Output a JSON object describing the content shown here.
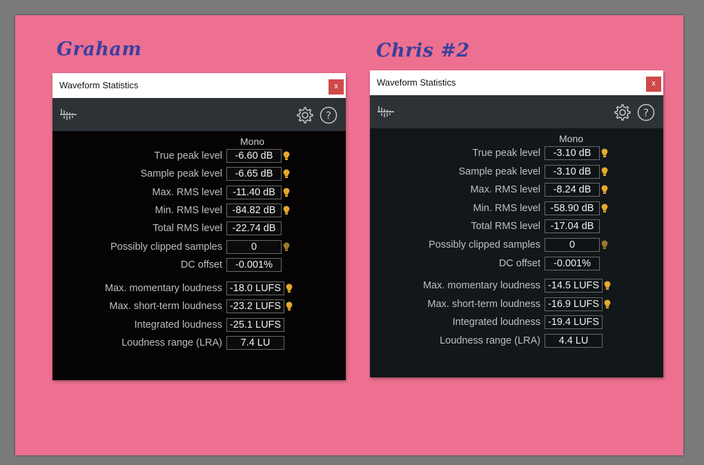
{
  "labels": {
    "left": "Graham",
    "right": "Chris #2"
  },
  "colors": {
    "background": "#ee7090",
    "bulb": "#e7a92b",
    "bulb_dim": "#9a7a2a",
    "close": "#cf4a4a"
  },
  "window": {
    "title": "Waveform Statistics",
    "close_label": "x",
    "column_header": "Mono",
    "icons": {
      "waveform": "waveform-icon",
      "settings": "gear-icon",
      "help": "help-icon"
    }
  },
  "stats_labels": [
    "True peak level",
    "Sample peak level",
    "Max. RMS level",
    "Min. RMS level",
    "Total RMS level",
    "Possibly clipped samples",
    "DC offset",
    "Max. momentary loudness",
    "Max. short-term loudness",
    "Integrated loudness",
    "Loudness range (LRA)"
  ],
  "graham": {
    "values": [
      "-6.60 dB",
      "-6.65 dB",
      "-11.40 dB",
      "-84.82 dB",
      "-22.74 dB",
      "0",
      "-0.001%",
      "-18.0 LUFS",
      "-23.2 LUFS",
      "-25.1 LUFS",
      "7.4 LU"
    ],
    "bulbs": [
      "on",
      "on",
      "on",
      "on",
      "none",
      "dim",
      "none",
      "on",
      "on",
      "none",
      "none"
    ]
  },
  "chris": {
    "values": [
      "-3.10 dB",
      "-3.10 dB",
      "-8.24 dB",
      "-58.90 dB",
      "-17.04 dB",
      "0",
      "-0.001%",
      "-14.5 LUFS",
      "-16.9 LUFS",
      "-19.4 LUFS",
      "4.4 LU"
    ],
    "bulbs": [
      "on",
      "on",
      "on",
      "on",
      "none",
      "dim",
      "none",
      "on",
      "on",
      "none",
      "none"
    ]
  }
}
